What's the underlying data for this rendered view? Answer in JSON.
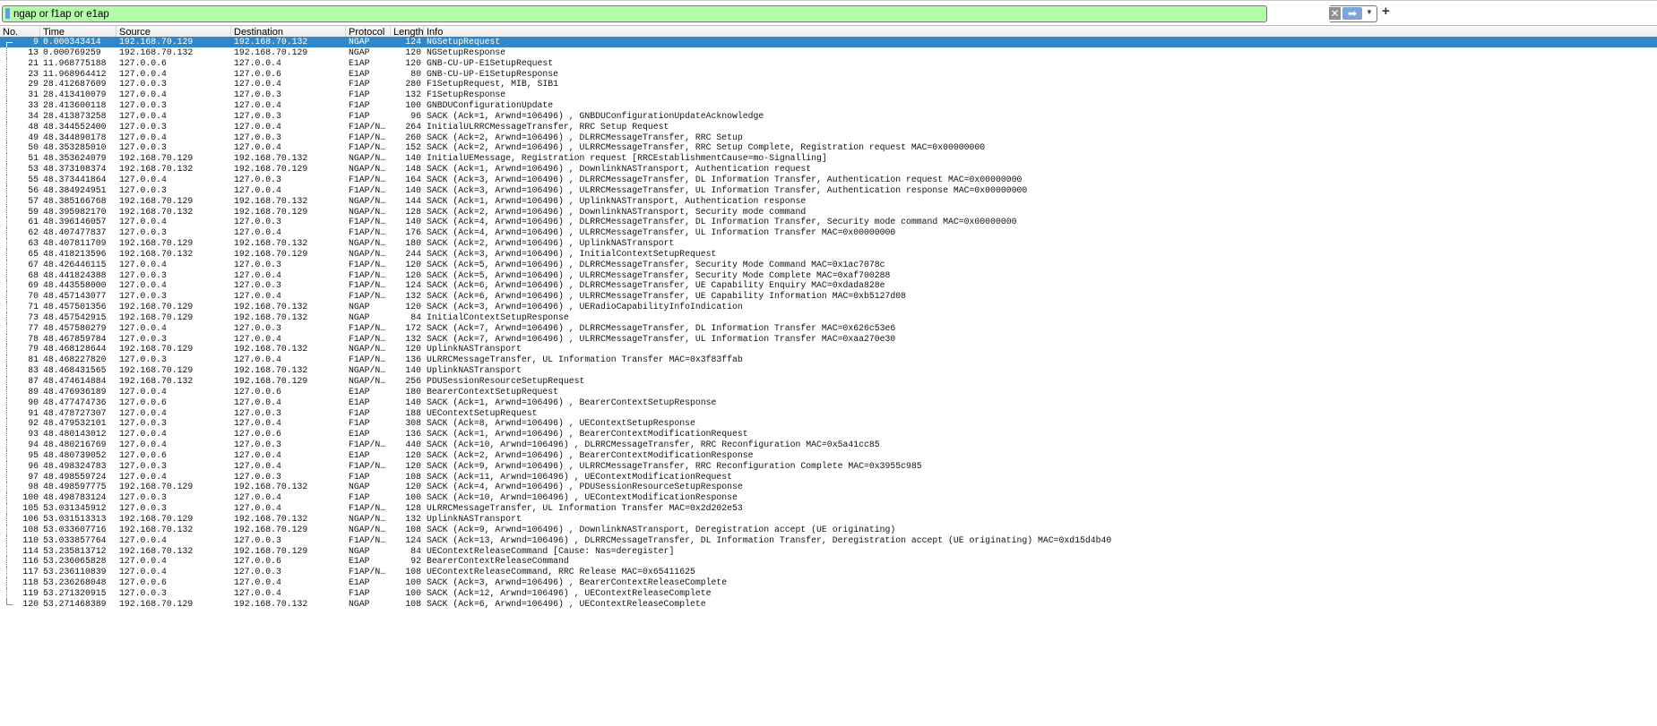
{
  "filter": {
    "value": "ngap or f1ap or e1ap",
    "clear_icon": "clear-icon",
    "apply_icon": "arrow-right-icon",
    "dropdown_icon": "chevron-down-icon",
    "add_icon": "plus-icon",
    "bg_color": "#b2fcaa"
  },
  "columns": {
    "no": "No.",
    "time": "Time",
    "source": "Source",
    "destination": "Destination",
    "protocol": "Protocol",
    "length": "Length",
    "info": "Info"
  },
  "selected_color": "#3088c8",
  "packets": [
    {
      "no": "9",
      "time": "0.000343414",
      "src": "192.168.70.129",
      "dst": "192.168.70.132",
      "proto": "NGAP",
      "len": "124",
      "info": "NGSetupRequest",
      "selected": true
    },
    {
      "no": "13",
      "time": "0.000769259",
      "src": "192.168.70.132",
      "dst": "192.168.70.129",
      "proto": "NGAP",
      "len": "120",
      "info": "NGSetupResponse"
    },
    {
      "no": "21",
      "time": "11.968775188",
      "src": "127.0.0.6",
      "dst": "127.0.0.4",
      "proto": "E1AP",
      "len": "120",
      "info": "GNB-CU-UP-E1SetupRequest"
    },
    {
      "no": "23",
      "time": "11.968964412",
      "src": "127.0.0.4",
      "dst": "127.0.0.6",
      "proto": "E1AP",
      "len": "80",
      "info": "GNB-CU-UP-E1SetupResponse"
    },
    {
      "no": "29",
      "time": "28.412687609",
      "src": "127.0.0.3",
      "dst": "127.0.0.4",
      "proto": "F1AP",
      "len": "280",
      "info": "F1SetupRequest, MIB, SIB1"
    },
    {
      "no": "31",
      "time": "28.413410079",
      "src": "127.0.0.4",
      "dst": "127.0.0.3",
      "proto": "F1AP",
      "len": "132",
      "info": "F1SetupResponse"
    },
    {
      "no": "33",
      "time": "28.413600118",
      "src": "127.0.0.3",
      "dst": "127.0.0.4",
      "proto": "F1AP",
      "len": "100",
      "info": "GNBDUConfigurationUpdate"
    },
    {
      "no": "34",
      "time": "28.413873258",
      "src": "127.0.0.4",
      "dst": "127.0.0.3",
      "proto": "F1AP",
      "len": "96",
      "info": "SACK (Ack=1, Arwnd=106496) , GNBDUConfigurationUpdateAcknowledge"
    },
    {
      "no": "48",
      "time": "48.344552400",
      "src": "127.0.0.3",
      "dst": "127.0.0.4",
      "proto": "F1AP/N…",
      "len": "264",
      "info": "InitialULRRCMessageTransfer, RRC Setup Request"
    },
    {
      "no": "49",
      "time": "48.344890178",
      "src": "127.0.0.4",
      "dst": "127.0.0.3",
      "proto": "F1AP/N…",
      "len": "260",
      "info": "SACK (Ack=2, Arwnd=106496) , DLRRCMessageTransfer, RRC Setup"
    },
    {
      "no": "50",
      "time": "48.353285010",
      "src": "127.0.0.3",
      "dst": "127.0.0.4",
      "proto": "F1AP/N…",
      "len": "152",
      "info": "SACK (Ack=2, Arwnd=106496) , ULRRCMessageTransfer, RRC Setup Complete, Registration request MAC=0x00000000"
    },
    {
      "no": "51",
      "time": "48.353624079",
      "src": "192.168.70.129",
      "dst": "192.168.70.132",
      "proto": "NGAP/N…",
      "len": "140",
      "info": "InitialUEMessage, Registration request [RRCEstablishmentCause=mo-Signalling]"
    },
    {
      "no": "53",
      "time": "48.373108374",
      "src": "192.168.70.132",
      "dst": "192.168.70.129",
      "proto": "NGAP/N…",
      "len": "148",
      "info": "SACK (Ack=1, Arwnd=106496) , DownlinkNASTransport, Authentication request"
    },
    {
      "no": "55",
      "time": "48.373441864",
      "src": "127.0.0.4",
      "dst": "127.0.0.3",
      "proto": "F1AP/N…",
      "len": "164",
      "info": "SACK (Ack=3, Arwnd=106496) , DLRRCMessageTransfer, DL Information Transfer, Authentication request MAC=0x00000000"
    },
    {
      "no": "56",
      "time": "48.384924951",
      "src": "127.0.0.3",
      "dst": "127.0.0.4",
      "proto": "F1AP/N…",
      "len": "140",
      "info": "SACK (Ack=3, Arwnd=106496) , ULRRCMessageTransfer, UL Information Transfer, Authentication response MAC=0x00000000"
    },
    {
      "no": "57",
      "time": "48.385166768",
      "src": "192.168.70.129",
      "dst": "192.168.70.132",
      "proto": "NGAP/N…",
      "len": "144",
      "info": "SACK (Ack=1, Arwnd=106496) , UplinkNASTransport, Authentication response"
    },
    {
      "no": "59",
      "time": "48.395982170",
      "src": "192.168.70.132",
      "dst": "192.168.70.129",
      "proto": "NGAP/N…",
      "len": "128",
      "info": "SACK (Ack=2, Arwnd=106496) , DownlinkNASTransport, Security mode command"
    },
    {
      "no": "61",
      "time": "48.396146057",
      "src": "127.0.0.4",
      "dst": "127.0.0.3",
      "proto": "F1AP/N…",
      "len": "140",
      "info": "SACK (Ack=4, Arwnd=106496) , DLRRCMessageTransfer, DL Information Transfer, Security mode command MAC=0x00000000"
    },
    {
      "no": "62",
      "time": "48.407477837",
      "src": "127.0.0.3",
      "dst": "127.0.0.4",
      "proto": "F1AP/N…",
      "len": "176",
      "info": "SACK (Ack=4, Arwnd=106496) , ULRRCMessageTransfer, UL Information Transfer MAC=0x00000000"
    },
    {
      "no": "63",
      "time": "48.407811709",
      "src": "192.168.70.129",
      "dst": "192.168.70.132",
      "proto": "NGAP/N…",
      "len": "180",
      "info": "SACK (Ack=2, Arwnd=106496) , UplinkNASTransport"
    },
    {
      "no": "65",
      "time": "48.418213596",
      "src": "192.168.70.132",
      "dst": "192.168.70.129",
      "proto": "NGAP/N…",
      "len": "244",
      "info": "SACK (Ack=3, Arwnd=106496) , InitialContextSetupRequest"
    },
    {
      "no": "67",
      "time": "48.426446115",
      "src": "127.0.0.4",
      "dst": "127.0.0.3",
      "proto": "F1AP/N…",
      "len": "120",
      "info": "SACK (Ack=5, Arwnd=106496) , DLRRCMessageTransfer, Security Mode Command MAC=0x1ac7078c"
    },
    {
      "no": "68",
      "time": "48.441824388",
      "src": "127.0.0.3",
      "dst": "127.0.0.4",
      "proto": "F1AP/N…",
      "len": "120",
      "info": "SACK (Ack=5, Arwnd=106496) , ULRRCMessageTransfer, Security Mode Complete MAC=0xaf700288"
    },
    {
      "no": "69",
      "time": "48.443558000",
      "src": "127.0.0.4",
      "dst": "127.0.0.3",
      "proto": "F1AP/N…",
      "len": "124",
      "info": "SACK (Ack=6, Arwnd=106496) , DLRRCMessageTransfer, UE Capability Enquiry MAC=0xdada828e"
    },
    {
      "no": "70",
      "time": "48.457143077",
      "src": "127.0.0.3",
      "dst": "127.0.0.4",
      "proto": "F1AP/N…",
      "len": "132",
      "info": "SACK (Ack=6, Arwnd=106496) , ULRRCMessageTransfer, UE Capability Information MAC=0xb5127d08"
    },
    {
      "no": "71",
      "time": "48.457501356",
      "src": "192.168.70.129",
      "dst": "192.168.70.132",
      "proto": "NGAP",
      "len": "120",
      "info": "SACK (Ack=3, Arwnd=106496) , UERadioCapabilityInfoIndication"
    },
    {
      "no": "73",
      "time": "48.457542915",
      "src": "192.168.70.129",
      "dst": "192.168.70.132",
      "proto": "NGAP",
      "len": "84",
      "info": "InitialContextSetupResponse"
    },
    {
      "no": "77",
      "time": "48.457580279",
      "src": "127.0.0.4",
      "dst": "127.0.0.3",
      "proto": "F1AP/N…",
      "len": "172",
      "info": "SACK (Ack=7, Arwnd=106496) , DLRRCMessageTransfer, DL Information Transfer MAC=0x626c53e6"
    },
    {
      "no": "78",
      "time": "48.467859784",
      "src": "127.0.0.3",
      "dst": "127.0.0.4",
      "proto": "F1AP/N…",
      "len": "132",
      "info": "SACK (Ack=7, Arwnd=106496) , ULRRCMessageTransfer, UL Information Transfer MAC=0xaa270e30"
    },
    {
      "no": "79",
      "time": "48.468128644",
      "src": "192.168.70.129",
      "dst": "192.168.70.132",
      "proto": "NGAP/N…",
      "len": "120",
      "info": "UplinkNASTransport"
    },
    {
      "no": "81",
      "time": "48.468227820",
      "src": "127.0.0.3",
      "dst": "127.0.0.4",
      "proto": "F1AP/N…",
      "len": "136",
      "info": "ULRRCMessageTransfer, UL Information Transfer MAC=0x3f83ffab"
    },
    {
      "no": "83",
      "time": "48.468431565",
      "src": "192.168.70.129",
      "dst": "192.168.70.132",
      "proto": "NGAP/N…",
      "len": "140",
      "info": "UplinkNASTransport"
    },
    {
      "no": "87",
      "time": "48.474614884",
      "src": "192.168.70.132",
      "dst": "192.168.70.129",
      "proto": "NGAP/N…",
      "len": "256",
      "info": "PDUSessionResourceSetupRequest"
    },
    {
      "no": "89",
      "time": "48.476936189",
      "src": "127.0.0.4",
      "dst": "127.0.0.6",
      "proto": "E1AP",
      "len": "180",
      "info": "BearerContextSetupRequest"
    },
    {
      "no": "90",
      "time": "48.477474736",
      "src": "127.0.0.6",
      "dst": "127.0.0.4",
      "proto": "E1AP",
      "len": "140",
      "info": "SACK (Ack=1, Arwnd=106496) , BearerContextSetupResponse"
    },
    {
      "no": "91",
      "time": "48.478727307",
      "src": "127.0.0.4",
      "dst": "127.0.0.3",
      "proto": "F1AP",
      "len": "188",
      "info": "UEContextSetupRequest"
    },
    {
      "no": "92",
      "time": "48.479532101",
      "src": "127.0.0.3",
      "dst": "127.0.0.4",
      "proto": "F1AP",
      "len": "308",
      "info": "SACK (Ack=8, Arwnd=106496) , UEContextSetupResponse"
    },
    {
      "no": "93",
      "time": "48.480143012",
      "src": "127.0.0.4",
      "dst": "127.0.0.6",
      "proto": "E1AP",
      "len": "136",
      "info": "SACK (Ack=1, Arwnd=106496) , BearerContextModificationRequest"
    },
    {
      "no": "94",
      "time": "48.480216769",
      "src": "127.0.0.4",
      "dst": "127.0.0.3",
      "proto": "F1AP/N…",
      "len": "440",
      "info": "SACK (Ack=10, Arwnd=106496) , DLRRCMessageTransfer, RRC Reconfiguration MAC=0x5a41cc85"
    },
    {
      "no": "95",
      "time": "48.480739052",
      "src": "127.0.0.6",
      "dst": "127.0.0.4",
      "proto": "E1AP",
      "len": "120",
      "info": "SACK (Ack=2, Arwnd=106496) , BearerContextModificationResponse"
    },
    {
      "no": "96",
      "time": "48.498324783",
      "src": "127.0.0.3",
      "dst": "127.0.0.4",
      "proto": "F1AP/N…",
      "len": "120",
      "info": "SACK (Ack=9, Arwnd=106496) , ULRRCMessageTransfer, RRC Reconfiguration Complete MAC=0x3955c985"
    },
    {
      "no": "97",
      "time": "48.498559724",
      "src": "127.0.0.4",
      "dst": "127.0.0.3",
      "proto": "F1AP",
      "len": "108",
      "info": "SACK (Ack=11, Arwnd=106496) , UEContextModificationRequest"
    },
    {
      "no": "98",
      "time": "48.498597775",
      "src": "192.168.70.129",
      "dst": "192.168.70.132",
      "proto": "NGAP",
      "len": "120",
      "info": "SACK (Ack=4, Arwnd=106496) , PDUSessionResourceSetupResponse"
    },
    {
      "no": "100",
      "time": "48.498783124",
      "src": "127.0.0.3",
      "dst": "127.0.0.4",
      "proto": "F1AP",
      "len": "100",
      "info": "SACK (Ack=10, Arwnd=106496) , UEContextModificationResponse"
    },
    {
      "no": "105",
      "time": "53.031345912",
      "src": "127.0.0.3",
      "dst": "127.0.0.4",
      "proto": "F1AP/N…",
      "len": "128",
      "info": "ULRRCMessageTransfer, UL Information Transfer MAC=0x2d202e53"
    },
    {
      "no": "106",
      "time": "53.031513313",
      "src": "192.168.70.129",
      "dst": "192.168.70.132",
      "proto": "NGAP/N…",
      "len": "132",
      "info": "UplinkNASTransport"
    },
    {
      "no": "108",
      "time": "53.033607716",
      "src": "192.168.70.132",
      "dst": "192.168.70.129",
      "proto": "NGAP/N…",
      "len": "108",
      "info": "SACK (Ack=9, Arwnd=106496) , DownlinkNASTransport, Deregistration accept (UE originating)"
    },
    {
      "no": "110",
      "time": "53.033857764",
      "src": "127.0.0.4",
      "dst": "127.0.0.3",
      "proto": "F1AP/N…",
      "len": "124",
      "info": "SACK (Ack=13, Arwnd=106496) , DLRRCMessageTransfer, DL Information Transfer, Deregistration accept (UE originating) MAC=0xd15d4b40"
    },
    {
      "no": "114",
      "time": "53.235813712",
      "src": "192.168.70.132",
      "dst": "192.168.70.129",
      "proto": "NGAP",
      "len": "84",
      "info": "UEContextReleaseCommand [Cause: Nas=deregister]"
    },
    {
      "no": "116",
      "time": "53.236065828",
      "src": "127.0.0.4",
      "dst": "127.0.0.6",
      "proto": "E1AP",
      "len": "92",
      "info": "BearerContextReleaseCommand"
    },
    {
      "no": "117",
      "time": "53.236110839",
      "src": "127.0.0.4",
      "dst": "127.0.0.3",
      "proto": "F1AP/N…",
      "len": "108",
      "info": "UEContextReleaseCommand, RRC Release MAC=0x65411625"
    },
    {
      "no": "118",
      "time": "53.236268048",
      "src": "127.0.0.6",
      "dst": "127.0.0.4",
      "proto": "E1AP",
      "len": "100",
      "info": "SACK (Ack=3, Arwnd=106496) , BearerContextReleaseComplete"
    },
    {
      "no": "119",
      "time": "53.271320915",
      "src": "127.0.0.3",
      "dst": "127.0.0.4",
      "proto": "F1AP",
      "len": "100",
      "info": "SACK (Ack=12, Arwnd=106496) , UEContextReleaseComplete"
    },
    {
      "no": "120",
      "time": "53.271468389",
      "src": "192.168.70.129",
      "dst": "192.168.70.132",
      "proto": "NGAP",
      "len": "108",
      "info": "SACK (Ack=6, Arwnd=106496) , UEContextReleaseComplete"
    }
  ]
}
